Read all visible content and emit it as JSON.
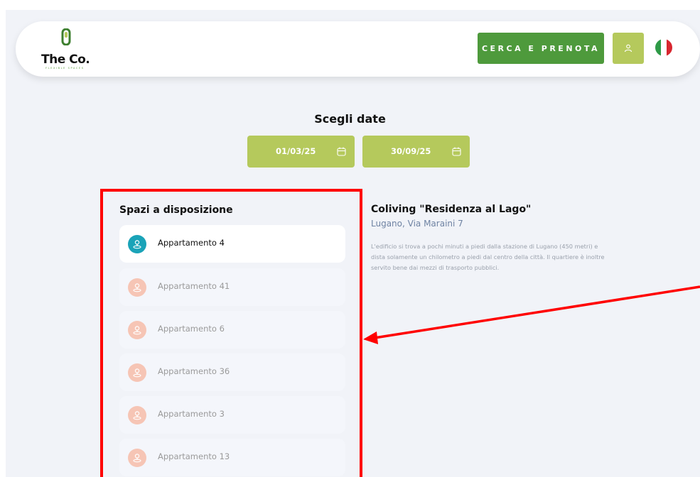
{
  "header": {
    "logo_text": "The Co.",
    "logo_tagline": "FLEXIBLE SPACES",
    "cta_label": "CERCA E PRENOTA",
    "user_icon": "user-icon",
    "flag": "italian-flag-icon"
  },
  "dates": {
    "title": "Scegli date",
    "start": "01/03/25",
    "end": "30/09/25",
    "calendar_icon": "calendar-icon"
  },
  "spaces": {
    "title": "Spazi a disposizione",
    "items": [
      {
        "label": "Appartamento 4",
        "active": true
      },
      {
        "label": "Appartamento 41",
        "active": false
      },
      {
        "label": "Appartamento 6",
        "active": false
      },
      {
        "label": "Appartamento 36",
        "active": false
      },
      {
        "label": "Appartamento 3",
        "active": false
      },
      {
        "label": "Appartamento 13",
        "active": false
      }
    ]
  },
  "place": {
    "title": "Coliving \"Residenza al Lago\"",
    "address": "Lugano, Via Maraini 7",
    "description": "L'edificio si trova a pochi minuti a piedi dalla stazione di Lugano (450 metri) e dista solamente un chilometro a piedi dal centro della città. Il quartiere è inoltre servito bene dai mezzi di trasporto pubblici."
  },
  "colors": {
    "primary_green": "#4e9a3c",
    "light_green": "#b5c95c",
    "active_pin": "#1aa3b8",
    "inactive_pin": "#f6c5b5",
    "address_blue": "#6f83a3",
    "annotation_red": "#ff0000"
  }
}
